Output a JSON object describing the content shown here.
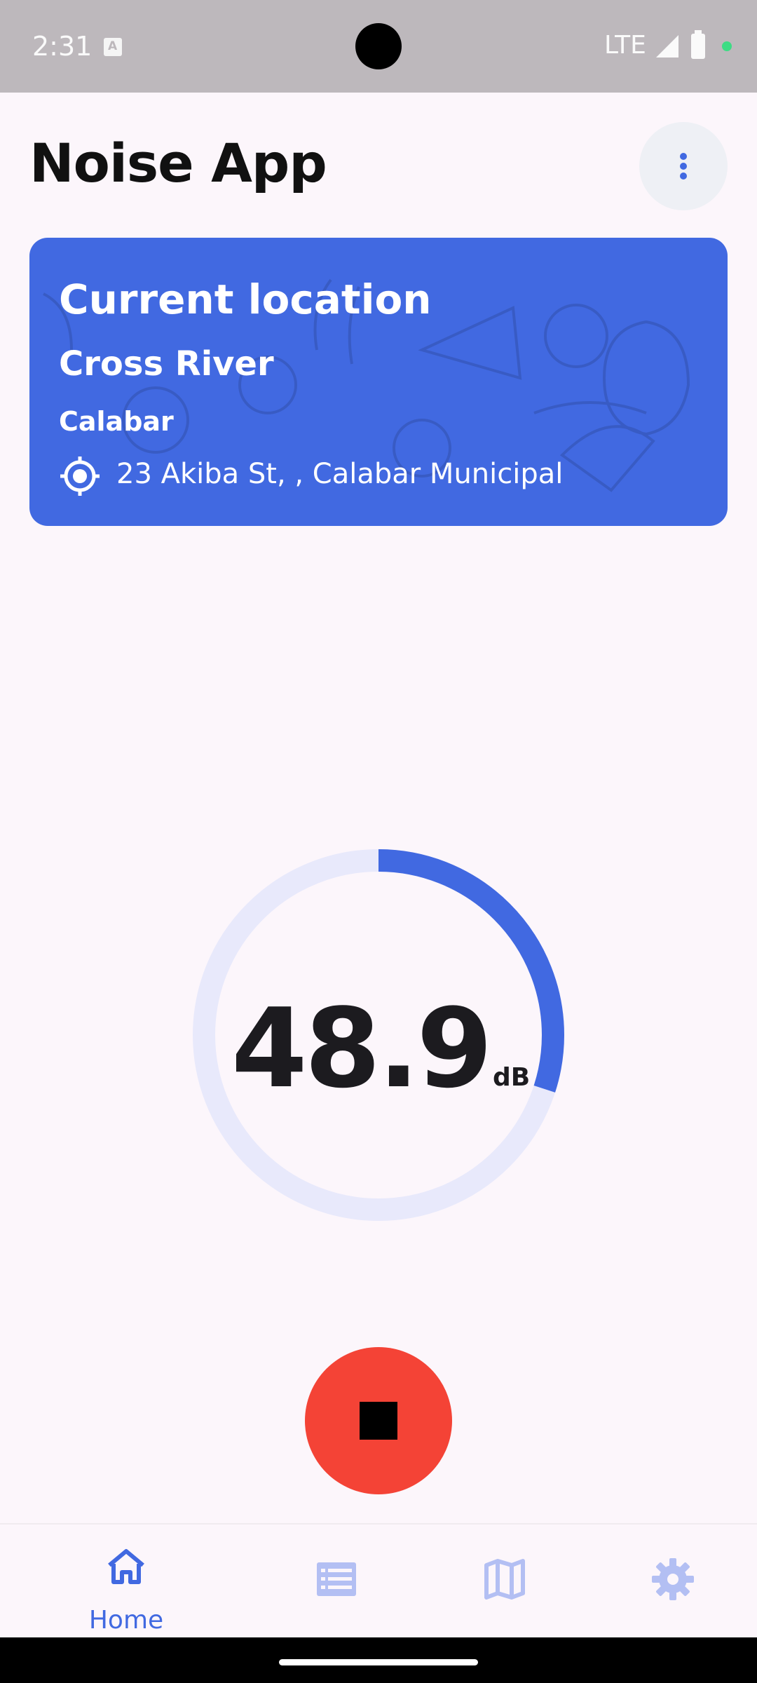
{
  "status_bar": {
    "time": "2:31",
    "network": "LTE",
    "icons": [
      "text-a-icon",
      "signal-icon",
      "battery-icon",
      "privacy-dot"
    ]
  },
  "header": {
    "title": "Noise App",
    "menu_icon": "more-vert-icon"
  },
  "location_card": {
    "title": "Current location",
    "state": "Cross River",
    "city": "Calabar",
    "address": "23 Akiba St, , Calabar Municipal",
    "address_icon": "gps-target-icon",
    "background_color": "#4169e1"
  },
  "meter": {
    "value": "48.9",
    "unit": "dB",
    "level_fraction": 0.3,
    "track_color": "#e8e9fb",
    "progress_color": "#4169e1"
  },
  "controls": {
    "stop_icon": "stop-icon",
    "stop_color": "#f44336"
  },
  "bottom_nav": {
    "items": [
      {
        "label": "Home",
        "icon": "home-icon",
        "active": true
      },
      {
        "label": "",
        "icon": "list-icon",
        "active": false
      },
      {
        "label": "",
        "icon": "map-icon",
        "active": false
      },
      {
        "label": "",
        "icon": "settings-icon",
        "active": false
      }
    ],
    "active_color": "#4169e1",
    "inactive_color": "#b3bff3"
  }
}
